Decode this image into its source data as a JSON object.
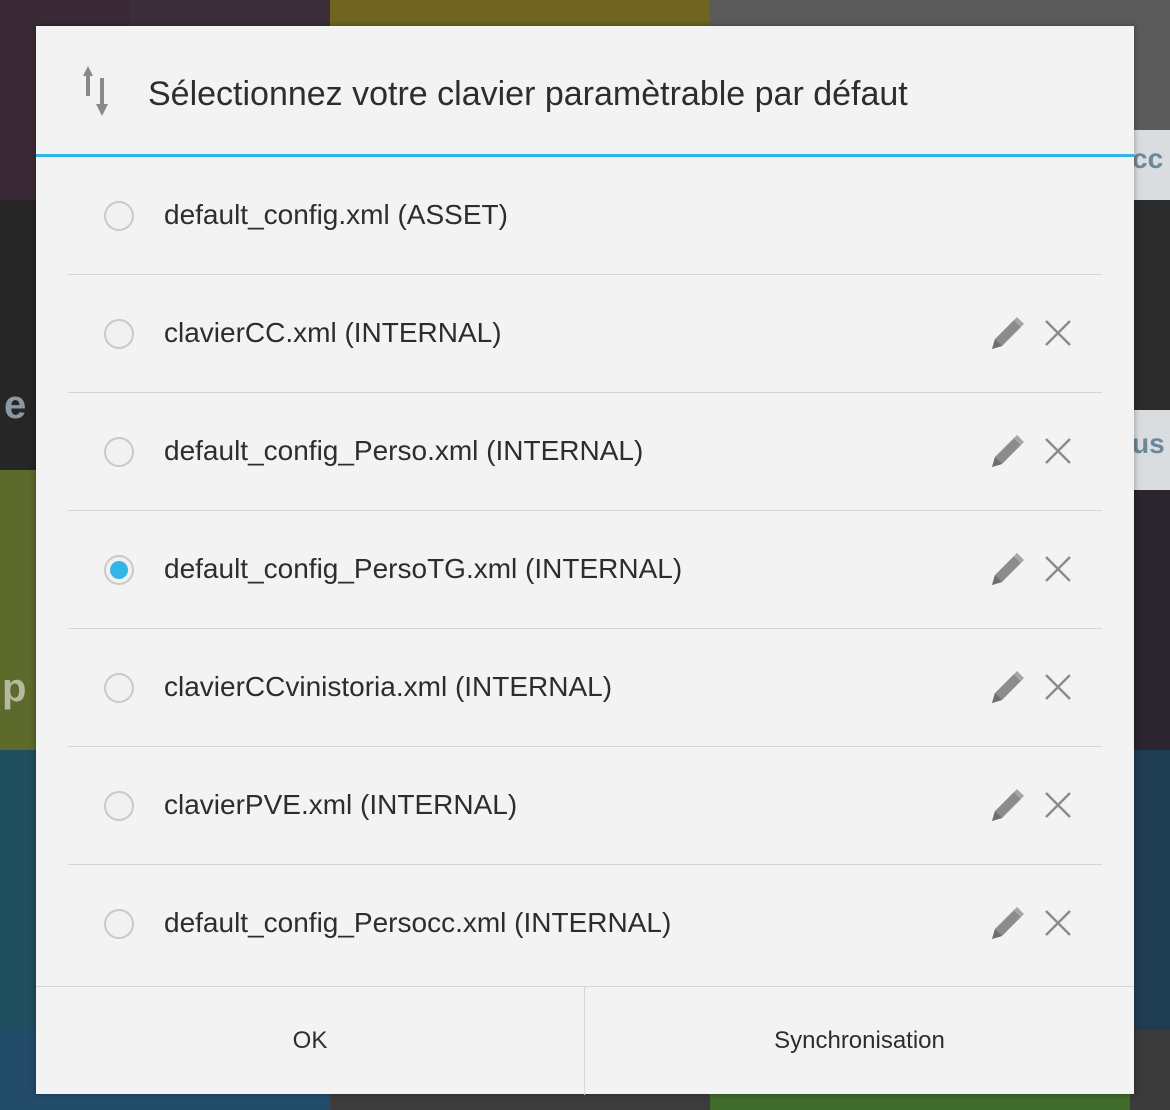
{
  "dialog": {
    "title": "Sélectionnez votre clavier paramètrable par défaut",
    "header_icon": "sort-arrows-icon",
    "accent_color": "#33b5e5",
    "options": [
      {
        "label": "default_config.xml (ASSET)",
        "selected": false,
        "editable": false
      },
      {
        "label": "clavierCC.xml (INTERNAL)",
        "selected": false,
        "editable": true
      },
      {
        "label": "default_config_Perso.xml (INTERNAL)",
        "selected": false,
        "editable": true
      },
      {
        "label": "default_config_PersoTG.xml (INTERNAL)",
        "selected": true,
        "editable": true
      },
      {
        "label": "clavierCCvinistoria.xml (INTERNAL)",
        "selected": false,
        "editable": true
      },
      {
        "label": "clavierPVE.xml (INTERNAL)",
        "selected": false,
        "editable": true
      },
      {
        "label": "default_config_Persocc.xml (INTERNAL)",
        "selected": false,
        "editable": true
      }
    ],
    "row_icons": {
      "edit": "pencil-icon",
      "delete": "close-icon"
    },
    "buttons": {
      "ok_label": "OK",
      "sync_label": "Synchronisation"
    }
  },
  "background": {
    "fragments": [
      "cc",
      "e",
      "us",
      "p"
    ]
  }
}
